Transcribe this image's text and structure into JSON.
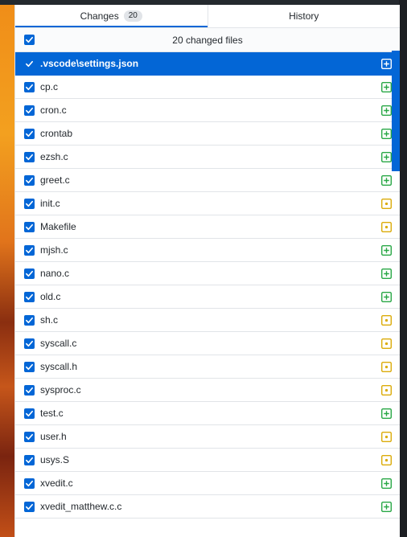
{
  "tabs": {
    "changes_label": "Changes",
    "changes_count": "20",
    "history_label": "History"
  },
  "header": {
    "title": "20 changed files"
  },
  "colors": {
    "accent": "#0366d6",
    "added": "#28a745",
    "modified": "#dbab09"
  },
  "files": [
    {
      "name": ".vscode\\settings.json",
      "status": "added",
      "checked": true,
      "selected": true
    },
    {
      "name": "cp.c",
      "status": "added",
      "checked": true
    },
    {
      "name": "cron.c",
      "status": "added",
      "checked": true
    },
    {
      "name": "crontab",
      "status": "added",
      "checked": true
    },
    {
      "name": "ezsh.c",
      "status": "added",
      "checked": true
    },
    {
      "name": "greet.c",
      "status": "added",
      "checked": true
    },
    {
      "name": "init.c",
      "status": "modified",
      "checked": true
    },
    {
      "name": "Makefile",
      "status": "modified",
      "checked": true
    },
    {
      "name": "mjsh.c",
      "status": "added",
      "checked": true
    },
    {
      "name": "nano.c",
      "status": "added",
      "checked": true
    },
    {
      "name": "old.c",
      "status": "added",
      "checked": true
    },
    {
      "name": "sh.c",
      "status": "modified",
      "checked": true
    },
    {
      "name": "syscall.c",
      "status": "modified",
      "checked": true
    },
    {
      "name": "syscall.h",
      "status": "modified",
      "checked": true
    },
    {
      "name": "sysproc.c",
      "status": "modified",
      "checked": true
    },
    {
      "name": "test.c",
      "status": "added",
      "checked": true
    },
    {
      "name": "user.h",
      "status": "modified",
      "checked": true
    },
    {
      "name": "usys.S",
      "status": "modified",
      "checked": true
    },
    {
      "name": "xvedit.c",
      "status": "added",
      "checked": true
    },
    {
      "name": "xvedit_matthew.c.c",
      "status": "added",
      "checked": true
    }
  ]
}
